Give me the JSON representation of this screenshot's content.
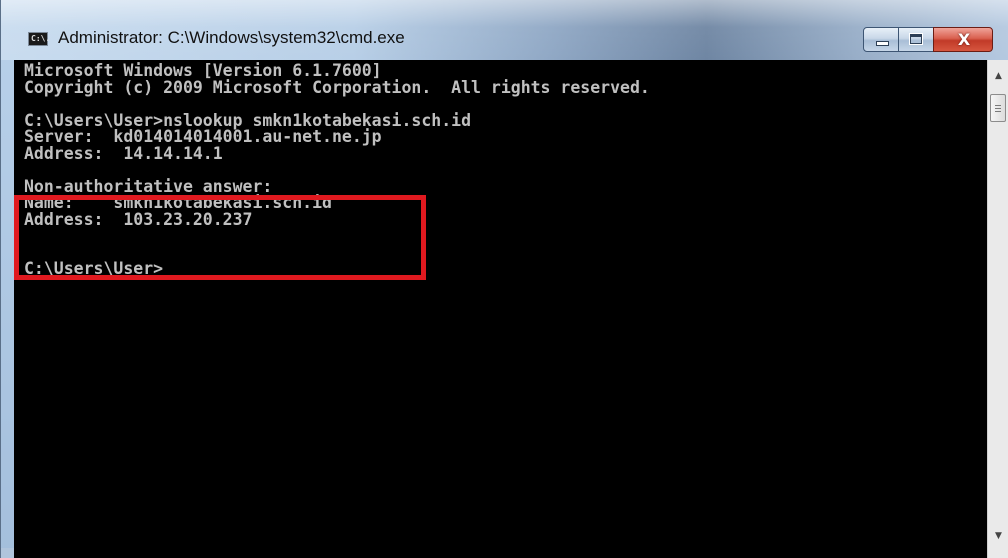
{
  "window": {
    "title": "Administrator: C:\\Windows\\system32\\cmd.exe",
    "icon_label": "C:\\.",
    "buttons": {
      "minimize": "minimize-icon",
      "maximize": "maximize-icon",
      "close": "close-icon",
      "close_glyph": "X"
    }
  },
  "console": {
    "lines": [
      "Microsoft Windows [Version 6.1.7600]",
      "Copyright (c) 2009 Microsoft Corporation.  All rights reserved.",
      "",
      "C:\\Users\\User>nslookup smkn1kotabekasi.sch.id",
      "Server:  kd014014014001.au-net.ne.jp",
      "Address:  14.14.14.1",
      "",
      "Non-authoritative answer:",
      "Name:    smkn1kotabekasi.sch.id",
      "Address:  103.23.20.237",
      "",
      "",
      "C:\\Users\\User>"
    ],
    "text_color": "#c0c0c0",
    "background_color": "#000000",
    "highlight_color": "#e0191f"
  },
  "scrollbar": {
    "up_arrow": "▲",
    "down_arrow": "▼"
  }
}
